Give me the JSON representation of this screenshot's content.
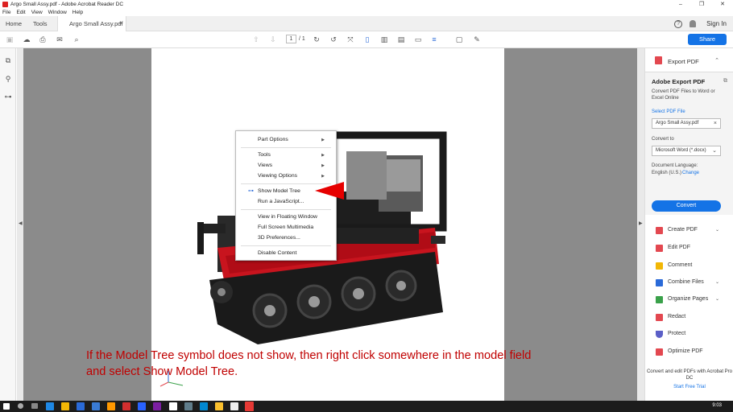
{
  "window": {
    "title": "Argo Small Assy.pdf - Adobe Acrobat Reader DC",
    "min": "–",
    "max": "❐",
    "close": "✕"
  },
  "menu": [
    "File",
    "Edit",
    "View",
    "Window",
    "Help"
  ],
  "tabs": {
    "home": "Home",
    "tools": "Tools",
    "doc": "Argo Small Assy.pdf",
    "doc_close": "×"
  },
  "header": {
    "help": "?",
    "sign_in": "Sign In",
    "share": "Share"
  },
  "toolbar": {
    "page_current": "1",
    "page_total": "/ 1"
  },
  "context_menu": {
    "items": [
      {
        "label": "Part Options",
        "submenu": true
      },
      {
        "label": "Tools",
        "submenu": true
      },
      {
        "label": "Views",
        "submenu": true
      },
      {
        "label": "Viewing Options",
        "submenu": true
      },
      {
        "label": "Show Model Tree",
        "submenu": false
      },
      {
        "label": "Run a JavaScript...",
        "submenu": false
      },
      {
        "label": "View in Floating Window",
        "submenu": false
      },
      {
        "label": "Full Screen Multimedia",
        "submenu": false
      },
      {
        "label": "3D Preferences...",
        "submenu": false
      },
      {
        "label": "Disable Content",
        "submenu": false
      }
    ],
    "submenu_arrow": "▶"
  },
  "caption": {
    "line1": "If the Model Tree symbol does not show, then right click somewhere in the model field",
    "line2": "and select Show Model Tree."
  },
  "right_panel": {
    "export_header": "Export PDF",
    "export_title": "Adobe Export PDF",
    "export_desc": "Convert PDF Files to Word or Excel Online",
    "select_file": "Select PDF File",
    "file_name": "Argo Small Assy.pdf",
    "convert_to_label": "Convert to",
    "convert_to_value": "Microsoft Word (*.docx)",
    "doc_lang_label": "Document Language:",
    "doc_lang_value": "English (U.S.)",
    "change": "Change",
    "convert_button": "Convert",
    "tools": [
      {
        "label": "Create PDF",
        "color": "#e34850",
        "chev": "⌄"
      },
      {
        "label": "Edit PDF",
        "color": "#e34850",
        "chev": ""
      },
      {
        "label": "Comment",
        "color": "#f2b705",
        "chev": ""
      },
      {
        "label": "Combine Files",
        "color": "#2a6ad8",
        "chev": "⌄"
      },
      {
        "label": "Organize Pages",
        "color": "#3aa14a",
        "chev": "⌄"
      },
      {
        "label": "Redact",
        "color": "#e34850",
        "chev": ""
      },
      {
        "label": "Protect",
        "color": "#5b5fc7",
        "chev": ""
      },
      {
        "label": "Optimize PDF",
        "color": "#e34850",
        "chev": ""
      }
    ],
    "promo": "Convert and edit PDFs with Acrobat Pro DC",
    "trial": "Start Free Trial"
  },
  "taskbar": {
    "time": "9:03"
  },
  "colors": {
    "accent": "#1473e6",
    "pointer": "#e60000",
    "caption": "#c00000"
  }
}
